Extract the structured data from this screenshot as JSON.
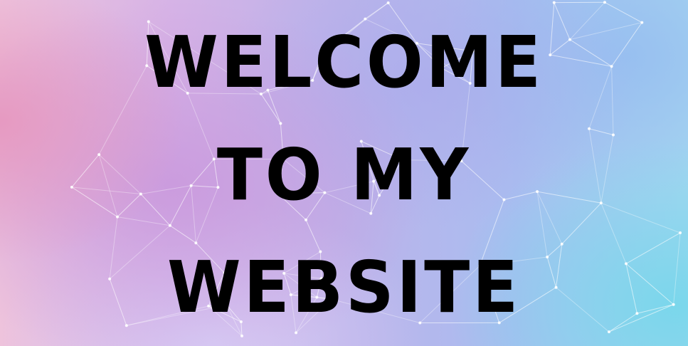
{
  "banner": {
    "lines": [
      "WELCOME",
      "TO MY",
      "WEBSITE"
    ]
  },
  "colors": {
    "text": "#000000",
    "left": "#eec3dc",
    "middle": "#bcb3ea",
    "right": "#a6d6f0"
  }
}
